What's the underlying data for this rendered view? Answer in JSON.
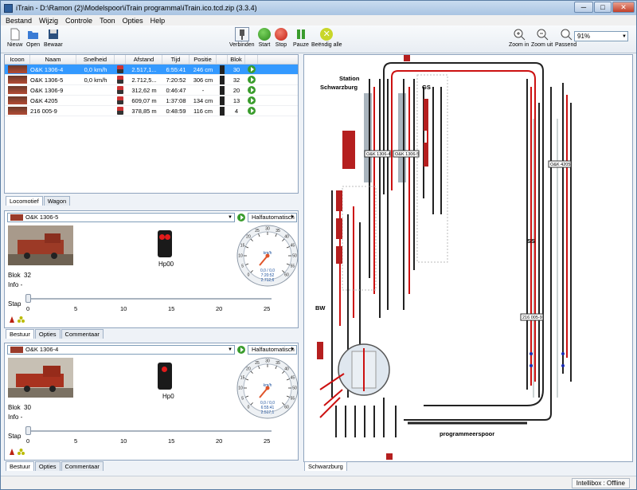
{
  "window": {
    "title": "iTrain - D:\\Ramon (2)\\Modelspoor\\iTrain programma\\iTrain.ico.tcd.zip (3.3.4)",
    "minimize": "─",
    "maximize": "□",
    "close": "✕"
  },
  "menu": [
    "Bestand",
    "Wijzig",
    "Controle",
    "Toon",
    "Opties",
    "Help"
  ],
  "toolbar": {
    "new": "Nieuw",
    "open": "Open",
    "save": "Bewaar",
    "connect": "Verbinden",
    "start": "Start",
    "stop": "Stop",
    "pause": "Pauze",
    "end_all": "Beëndig alle",
    "zoom_in": "Zoom in",
    "zoom_out": "Zoom uit",
    "fit": "Passend",
    "zoom": "91%"
  },
  "loco_table": {
    "headers": [
      "Icoon",
      "Naam",
      "Snelheid",
      "",
      "Afstand",
      "Tijd",
      "Positie",
      "",
      "Blok",
      ""
    ],
    "rows": [
      {
        "name": "O&K 1306-4",
        "speed": "0,0 km/h",
        "distance": "2.517,1...",
        "time": "6:55:41",
        "position": "246 cm",
        "block": "30",
        "selected": true
      },
      {
        "name": "O&K 1306-5",
        "speed": "0,0 km/h",
        "distance": "2.712,5...",
        "time": "7:20:52",
        "position": "306 cm",
        "block": "32",
        "selected": false
      },
      {
        "name": "O&K 1306-9",
        "speed": "",
        "distance": "312,62 m",
        "time": "0:46:47",
        "position": "-",
        "block": "20",
        "selected": false
      },
      {
        "name": "O&K 4205",
        "speed": "",
        "distance": "609,07 m",
        "time": "1:37:08",
        "position": "134 cm",
        "block": "13",
        "selected": false
      },
      {
        "name": "216 005-9",
        "speed": "",
        "distance": "378,85 m",
        "time": "0:48:59",
        "position": "116 cm",
        "block": "4",
        "selected": false
      }
    ]
  },
  "left_tabs": [
    "Locomotief",
    "Wagon"
  ],
  "cab1": {
    "loco": "O&K 1306-5",
    "mode": "Halfautomatisch",
    "signal": "Hp00",
    "block_label": "Blok",
    "block": "32",
    "info_label": "Info",
    "info": "-",
    "step_label": "Stap",
    "ticks": [
      "0",
      "5",
      "10",
      "15",
      "20",
      "25"
    ],
    "speed_unit": "km/h",
    "dial_speed": "0,0 / 0,0",
    "dial_time": "7:20:52",
    "dial_dist": "2.712,6",
    "tabs": [
      "Bestuur",
      "Opties",
      "Commentaar"
    ]
  },
  "cab2": {
    "loco": "O&K 1306-4",
    "mode": "Halfautomatisch",
    "signal": "Hp0",
    "block_label": "Blok",
    "block": "30",
    "info_label": "Info",
    "info": "-",
    "step_label": "Stap",
    "ticks": [
      "0",
      "5",
      "10",
      "15",
      "20",
      "25"
    ],
    "speed_unit": "km/h",
    "dial_speed": "0,0 / 0,0",
    "dial_time": "6:55:41",
    "dial_dist": "2.517,1",
    "tabs": [
      "Bestuur",
      "Opties",
      "Commentaar"
    ]
  },
  "dial_ticks": [
    "0",
    "5",
    "10",
    "15",
    "20",
    "25",
    "30",
    "35",
    "40",
    "45",
    "50",
    "55",
    "60"
  ],
  "map": {
    "labels": {
      "station": "Station",
      "station_name": "Schwarzburg",
      "gs": "GS",
      "ss": "SS",
      "bw": "BW",
      "prog": "programmeerspoor"
    },
    "loco_tags": [
      "O&K 1306-4",
      "O&K 1306-5",
      "O&K 4205",
      "216 005-9"
    ],
    "tab": "Schwarzburg"
  },
  "status": {
    "intellibox": "Intellibox : Offline"
  }
}
